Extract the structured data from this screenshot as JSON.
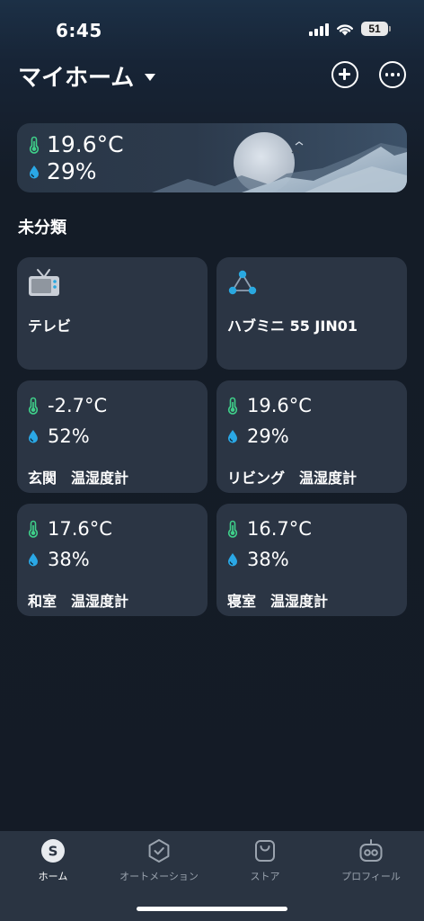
{
  "status_bar": {
    "time": "6:45",
    "battery": "51"
  },
  "header": {
    "title": "マイホーム"
  },
  "weather": {
    "temperature": "19.6°C",
    "humidity": "29%"
  },
  "section": {
    "label": "未分類"
  },
  "devices": [
    {
      "name": "テレビ",
      "icon": "tv-icon"
    },
    {
      "name": "ハブミニ 55 JIN01",
      "icon": "hub-icon"
    }
  ],
  "sensors": [
    {
      "temperature": "-2.7°C",
      "humidity": "52%",
      "name": "玄関　温湿度計"
    },
    {
      "temperature": "19.6°C",
      "humidity": "29%",
      "name": "リビング　温湿度計"
    },
    {
      "temperature": "17.6°C",
      "humidity": "38%",
      "name": "和室　温湿度計"
    },
    {
      "temperature": "16.7°C",
      "humidity": "38%",
      "name": "寝室　温湿度計"
    }
  ],
  "tabs": [
    {
      "label": "ホーム",
      "icon": "home-icon",
      "active": true
    },
    {
      "label": "オートメーション",
      "icon": "automation-icon",
      "active": false
    },
    {
      "label": "ストア",
      "icon": "store-icon",
      "active": false
    },
    {
      "label": "プロフィール",
      "icon": "profile-icon",
      "active": false
    }
  ],
  "colors": {
    "background": "#141c27",
    "card": "#2b3544",
    "thermometer": "#3fd08a",
    "humidity": "#2aa8e6",
    "accent": "#29a8e0"
  }
}
